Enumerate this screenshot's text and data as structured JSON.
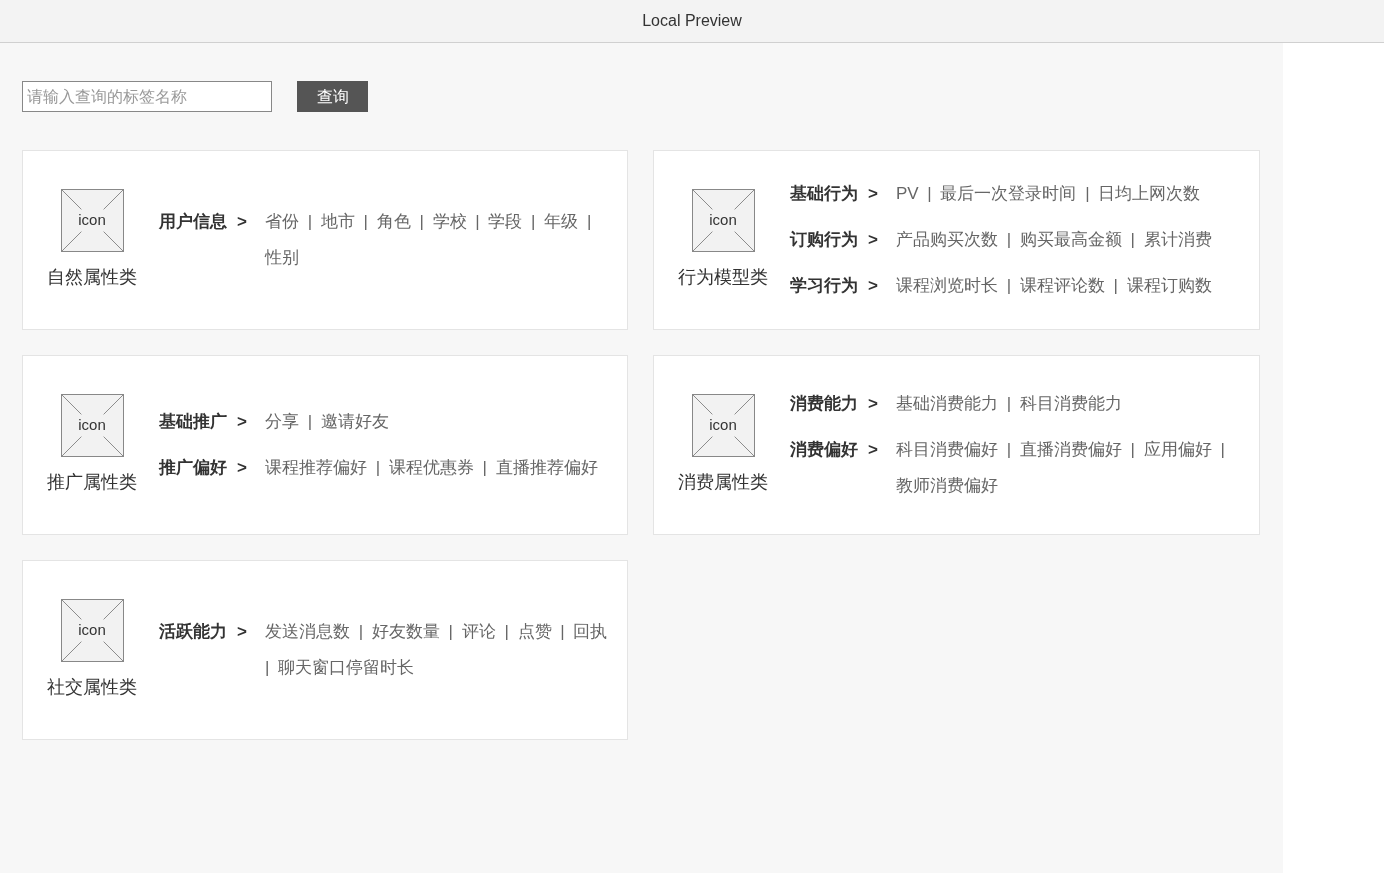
{
  "window": {
    "title": "Local Preview"
  },
  "search": {
    "placeholder": "请输入查询的标签名称",
    "button": "查询"
  },
  "cards": [
    {
      "icon_text": "icon",
      "name": "自然属性类",
      "groups": [
        {
          "label": "用户信息",
          "arrow": ">",
          "values": "省份 | 地市 | 角色 | 学校 | 学段 | 年级 | 性别"
        }
      ]
    },
    {
      "icon_text": "icon",
      "name": "行为模型类",
      "groups": [
        {
          "label": "基础行为",
          "arrow": ">",
          "values": "PV | 最后一次登录时间 | 日均上网次数"
        },
        {
          "label": "订购行为",
          "arrow": ">",
          "values": "产品购买次数 | 购买最高金额 | 累计消费"
        },
        {
          "label": "学习行为",
          "arrow": ">",
          "values": "课程浏览时长 | 课程评论数 | 课程订购数"
        }
      ]
    },
    {
      "icon_text": "icon",
      "name": "推广属性类",
      "groups": [
        {
          "label": "基础推广",
          "arrow": ">",
          "values": "分享 | 邀请好友"
        },
        {
          "label": "推广偏好",
          "arrow": ">",
          "values": "课程推荐偏好 | 课程优惠券 | 直播推荐偏好"
        }
      ]
    },
    {
      "icon_text": "icon",
      "name": "消费属性类",
      "groups": [
        {
          "label": "消费能力",
          "arrow": ">",
          "values": "基础消费能力 | 科目消费能力"
        },
        {
          "label": "消费偏好",
          "arrow": ">",
          "values": "科目消费偏好 | 直播消费偏好 | 应用偏好 | 教师消费偏好"
        }
      ]
    },
    {
      "icon_text": "icon",
      "name": "社交属性类",
      "groups": [
        {
          "label": "活跃能力",
          "arrow": ">",
          "values": "发送消息数 | 好友数量 | 评论 | 点赞 | 回执 | 聊天窗口停留时长"
        }
      ]
    }
  ]
}
